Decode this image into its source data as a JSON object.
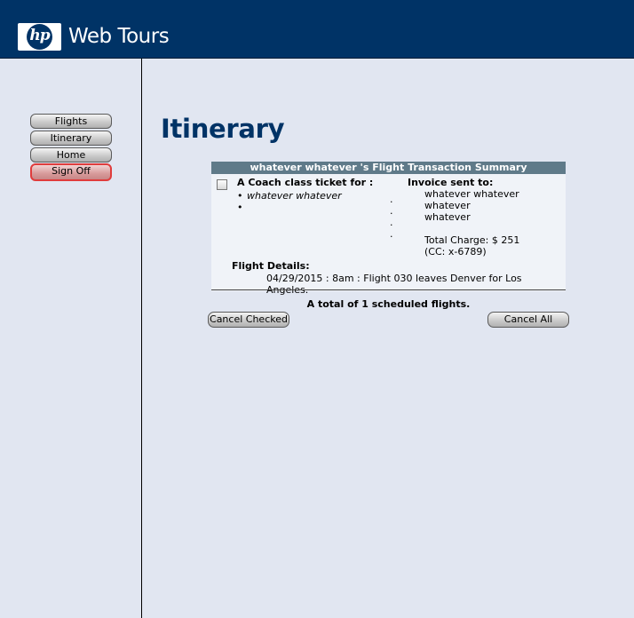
{
  "header": {
    "logo_text": "hp",
    "brand": "Web Tours"
  },
  "sidebar": {
    "items": [
      {
        "label": "Flights"
      },
      {
        "label": "Itinerary"
      },
      {
        "label": "Home"
      },
      {
        "label": "Sign Off"
      }
    ]
  },
  "main": {
    "title": "Itinerary",
    "summary": {
      "header": "whatever whatever 's Flight Transaction Summary",
      "ticket_label": "A Coach class ticket for :",
      "passengers": [
        "whatever whatever",
        ""
      ],
      "invoice_label": "Invoice sent to:",
      "invoice_lines": [
        "whatever whatever",
        "whatever",
        "whatever"
      ],
      "total_charge": "Total Charge: $ 251",
      "card": "(CC: x-6789)",
      "flight_details_label": "Flight Details:",
      "flight_details": "04/29/2015 : 8am : Flight 030 leaves Denver  for Los Angeles."
    },
    "total_text": "A total of 1 scheduled flights.",
    "cancel_checked_label": "Cancel Checked",
    "cancel_all_label": "Cancel All"
  }
}
